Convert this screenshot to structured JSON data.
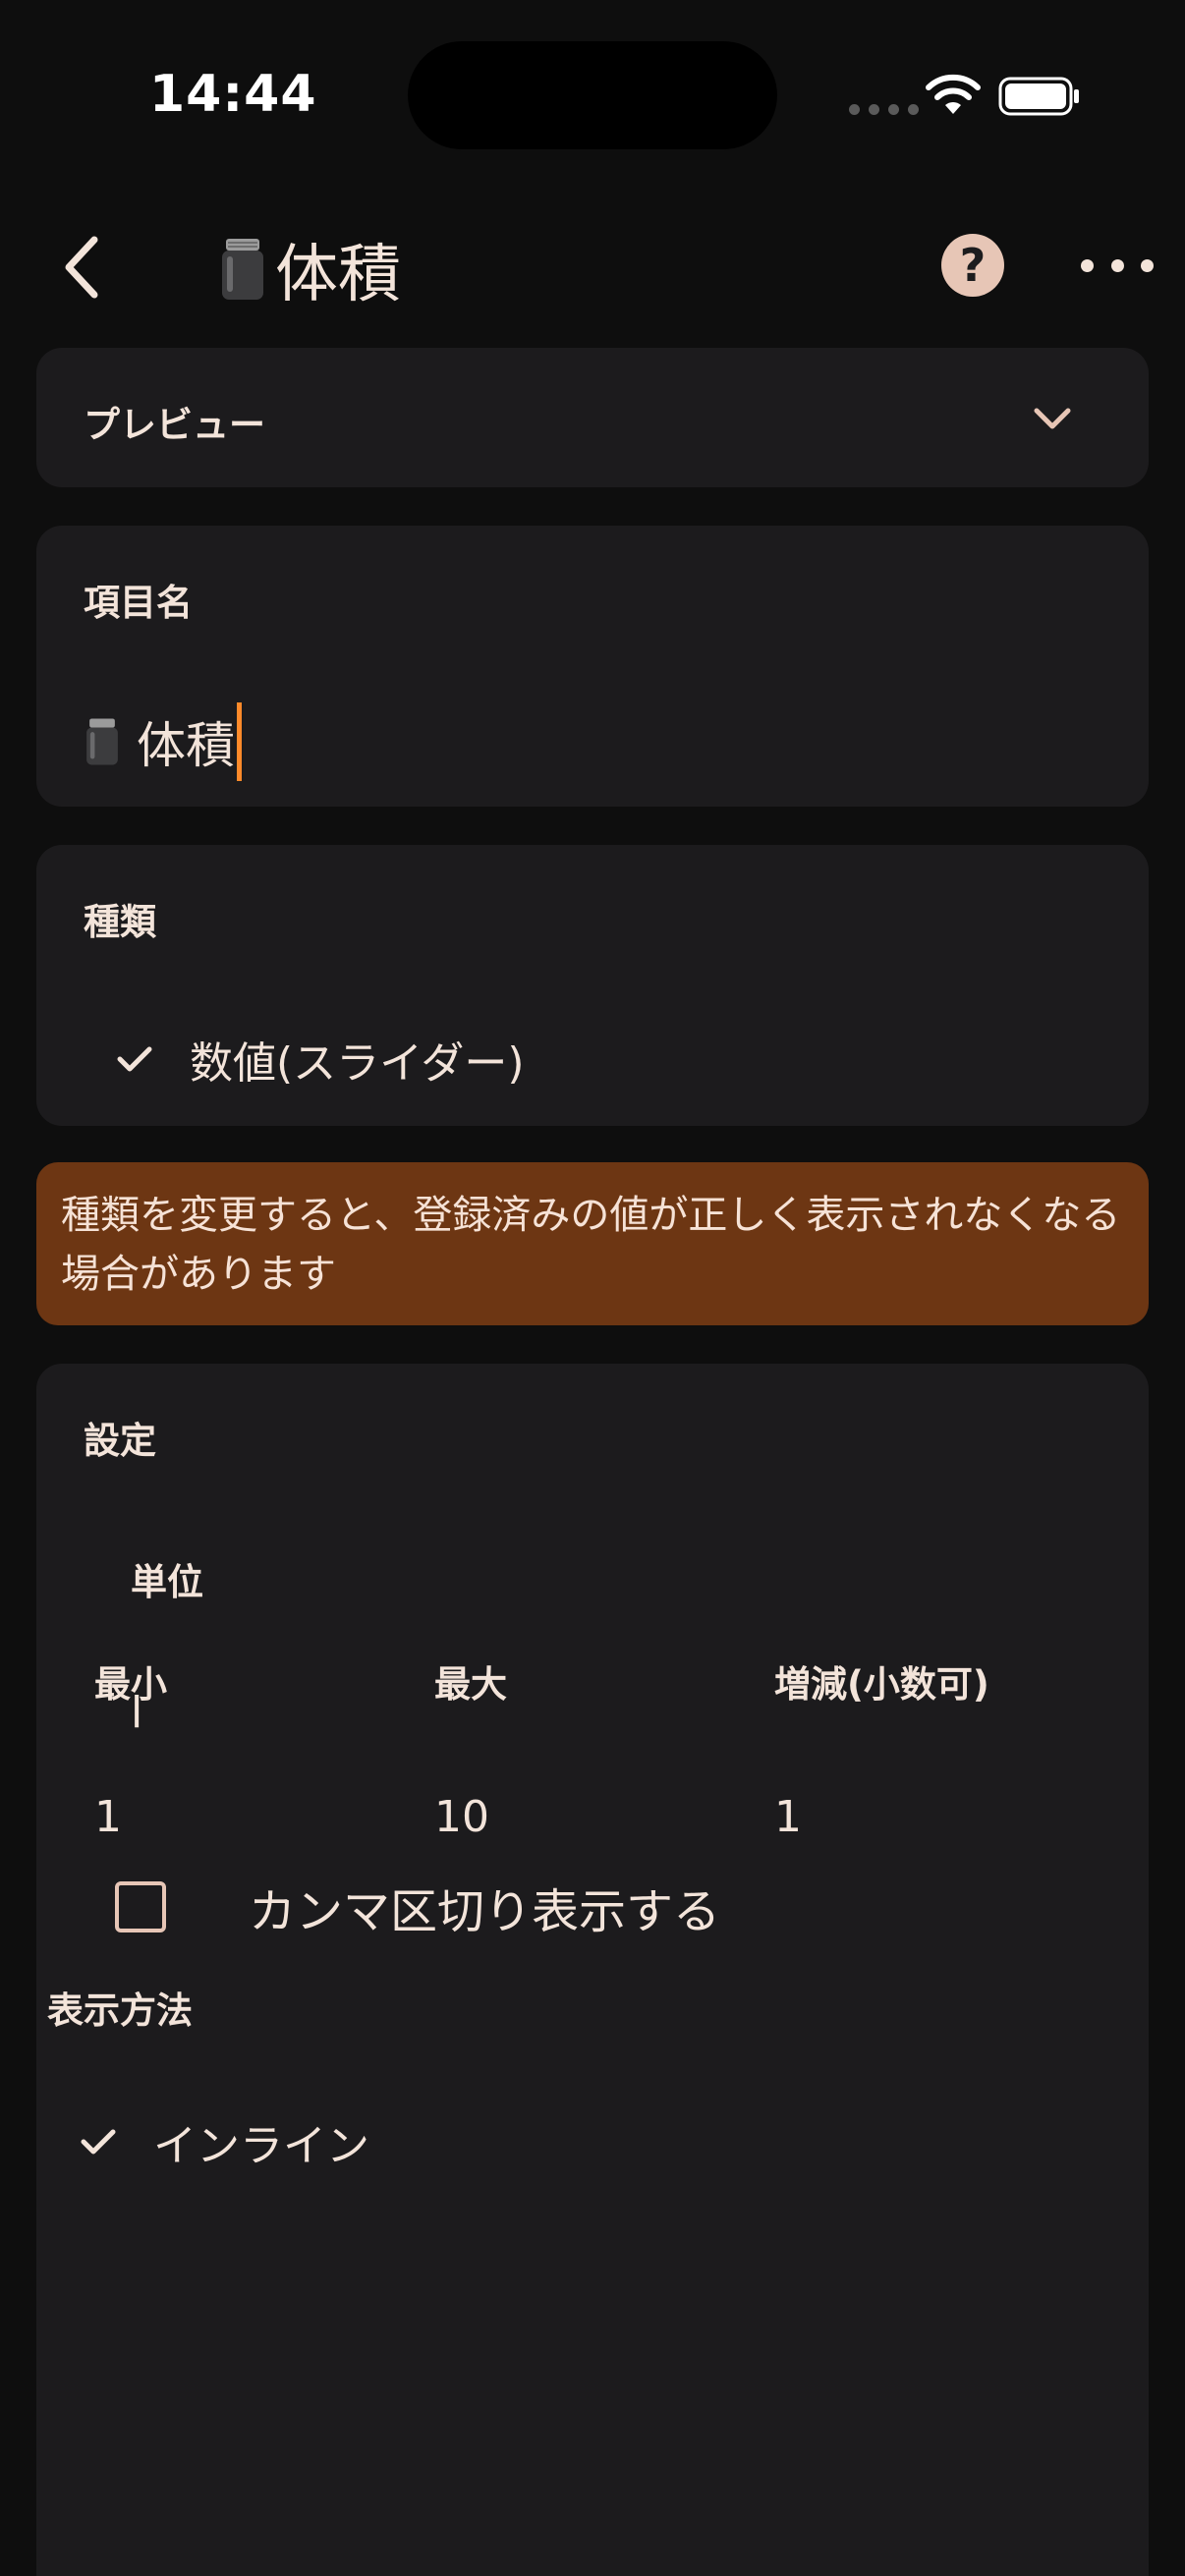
{
  "status_bar": {
    "time": "14:44"
  },
  "nav": {
    "title": "体積",
    "title_icon": "jar-icon",
    "back_icon": "chevron-left-icon",
    "help_label": "?",
    "more_icon": "more-horizontal-icon"
  },
  "preview": {
    "label": "プレビュー",
    "expand_icon": "chevron-down-icon"
  },
  "item_name": {
    "label": "項目名",
    "value": "体積",
    "icon": "jar-icon"
  },
  "type": {
    "label": "種類",
    "selected": "数値(スライダー)",
    "check_icon": "checkmark-icon"
  },
  "warning": {
    "text": "種類を変更すると、登録済みの値が正しく表示されなくなる場合があります"
  },
  "settings": {
    "label": "設定",
    "unit_label": "単位",
    "unit_value": "l",
    "comma_label": "カンマ区切り表示する",
    "comma_checked": false,
    "min_label": "最小",
    "max_label": "最大",
    "step_label": "増減(小数可)",
    "min_value": "1",
    "max_value": "10",
    "step_value": "1",
    "display_label": "表示方法",
    "display_selected": "インライン"
  },
  "colors": {
    "background": "#0e0e0e",
    "card": "#1c1b1d",
    "accent": "#ff8a2a",
    "warning_bg": "#6d3613",
    "text": "#f3e4da",
    "help_bg": "#e7c6b6"
  }
}
